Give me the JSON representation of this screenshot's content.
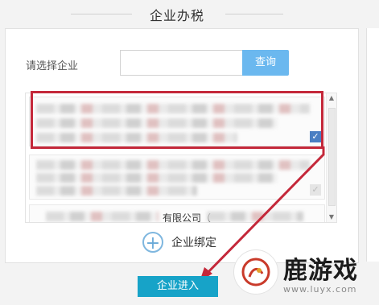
{
  "section": {
    "title": "企业办税"
  },
  "search": {
    "label": "请选择企业",
    "placeholder": "",
    "button_label": "查询"
  },
  "companies": [
    {
      "name_visible": "",
      "selected": true
    },
    {
      "name_visible": "",
      "selected": false
    },
    {
      "name_visible": "有限公司（"
    }
  ],
  "actions": {
    "bind_label": "企业绑定",
    "enter_label": "企业进入"
  },
  "watermark": {
    "title": "鹿游戏",
    "url": "www.luyx.com"
  },
  "colors": {
    "accent": "#6bb8ef",
    "enter_button": "#17a3c8",
    "highlight": "#c4283a",
    "check": "#4a7fc3"
  },
  "icons": {
    "add": "plus-circle-icon",
    "selected": "checkmark-icon"
  }
}
